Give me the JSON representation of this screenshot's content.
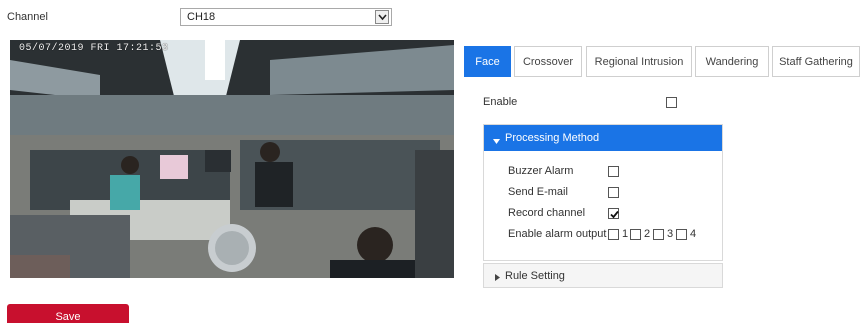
{
  "channel": {
    "label": "Channel",
    "value": "CH18"
  },
  "video": {
    "osd_timestamp": "05/07/2019 FRI 17:21:53"
  },
  "tabs": [
    {
      "label": "Face",
      "active": true
    },
    {
      "label": "Crossover",
      "active": false
    },
    {
      "label": "Regional Intrusion",
      "active": false
    },
    {
      "label": "Wandering",
      "active": false
    },
    {
      "label": "Staff Gathering",
      "active": false
    }
  ],
  "enable": {
    "label": "Enable",
    "checked": false
  },
  "processing": {
    "title": "Processing Method",
    "expanded": true,
    "buzzer_alarm": {
      "label": "Buzzer Alarm",
      "checked": false
    },
    "send_email": {
      "label": "Send E-mail",
      "checked": false
    },
    "record_channel": {
      "label": "Record channel",
      "checked": true
    },
    "alarm_output": {
      "label": "Enable alarm output",
      "outputs": [
        {
          "label": "1",
          "checked": false
        },
        {
          "label": "2",
          "checked": false
        },
        {
          "label": "3",
          "checked": false
        },
        {
          "label": "4",
          "checked": false
        }
      ]
    }
  },
  "rule_setting": {
    "title": "Rule Setting",
    "expanded": false
  },
  "save": {
    "label": "Save"
  },
  "colors": {
    "accent": "#1a74e6",
    "save": "#c8102e"
  }
}
